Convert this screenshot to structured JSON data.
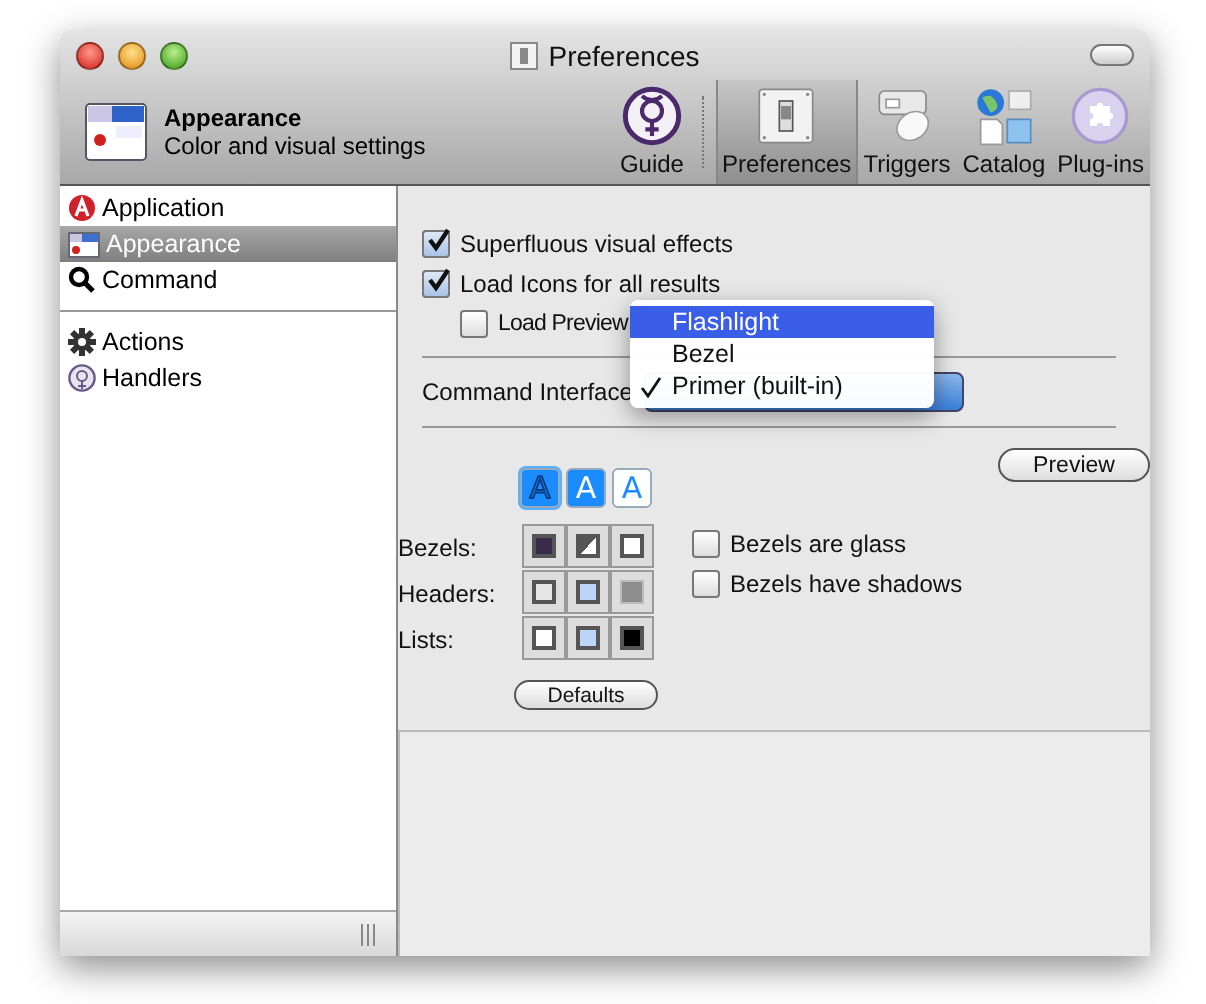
{
  "window": {
    "title": "Preferences"
  },
  "header": {
    "title": "Appearance",
    "subtitle": "Color and visual settings"
  },
  "toolbar": [
    {
      "label": "Guide",
      "selected": false
    },
    {
      "label": "Preferences",
      "selected": true
    },
    {
      "label": "Triggers",
      "selected": false
    },
    {
      "label": "Catalog",
      "selected": false
    },
    {
      "label": "Plug-ins",
      "selected": false
    }
  ],
  "sidebar": {
    "groups": [
      {
        "items": [
          {
            "label": "Application",
            "selected": false
          },
          {
            "label": "Appearance",
            "selected": true
          },
          {
            "label": "Command",
            "selected": false
          }
        ]
      },
      {
        "items": [
          {
            "label": "Actions",
            "selected": false
          },
          {
            "label": "Handlers",
            "selected": false
          }
        ]
      }
    ]
  },
  "options": [
    {
      "label": "Superfluous visual effects",
      "checked": true
    },
    {
      "label": "Load Icons for all results",
      "checked": true,
      "children": [
        {
          "label": "Load Preview",
          "checked": false
        }
      ]
    }
  ],
  "command_interface": {
    "label": "Command Interface",
    "menu": [
      {
        "label": "Flashlight",
        "highlighted": true,
        "checked": false
      },
      {
        "label": "Bezel",
        "highlighted": false,
        "checked": false
      },
      {
        "label": "Primer (built-in)",
        "highlighted": false,
        "checked": true
      }
    ]
  },
  "preview_button": "Preview",
  "font_styles": [
    {
      "label": "A",
      "kind": "outline",
      "selected": true
    },
    {
      "label": "A",
      "kind": "filled",
      "selected": false
    },
    {
      "label": "A",
      "kind": "plain",
      "selected": false
    }
  ],
  "color_rows": [
    {
      "label": "Bezels:",
      "swatches": [
        {
          "kind": "split",
          "color": "#3b2b4b"
        },
        {
          "kind": "split",
          "color": "#555555"
        },
        {
          "kind": "solid",
          "color": "#ffffff"
        }
      ]
    },
    {
      "label": "Headers:",
      "swatches": [
        {
          "kind": "solid",
          "color": "#e6e6e6"
        },
        {
          "kind": "solid",
          "color": "#bcd4f8"
        },
        {
          "kind": "flat",
          "color": "#8e8e8e"
        }
      ]
    },
    {
      "label": "Lists:",
      "swatches": [
        {
          "kind": "solid",
          "color": "#ffffff"
        },
        {
          "kind": "solid",
          "color": "#bcd4f8"
        },
        {
          "kind": "solid",
          "color": "#000000"
        }
      ]
    }
  ],
  "bezel_options": [
    {
      "label": "Bezels are glass",
      "checked": false
    },
    {
      "label": "Bezels have shadows",
      "checked": false
    }
  ],
  "defaults_button": "Defaults"
}
